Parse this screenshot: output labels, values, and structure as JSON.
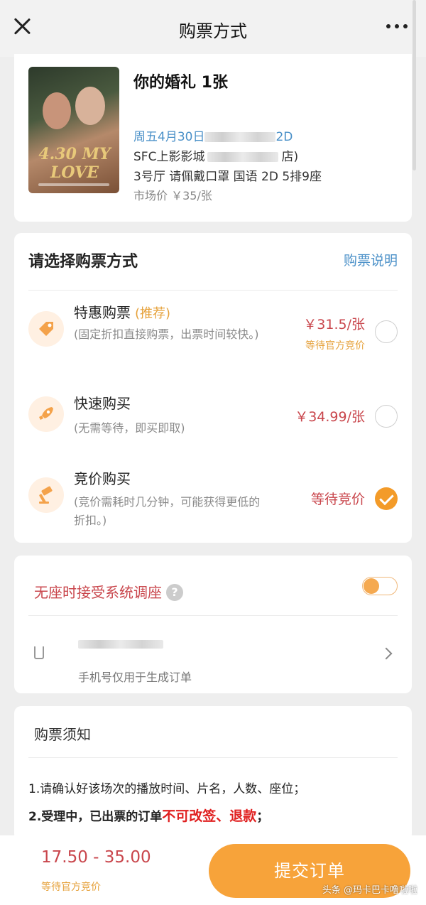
{
  "header": {
    "title": "购票方式"
  },
  "movie": {
    "title": "你的婚礼  1张",
    "showtime": "周五4月30日",
    "showtime_tail": "2D",
    "cinema_prefix": "SFC上影影城",
    "cinema_suffix": "店)",
    "hall": "3号厅 请佩戴口罩 国语 2D 5排9座",
    "market_price": "市场价 ￥35/张",
    "poster_title": "4.30 MY LOVE"
  },
  "methods": {
    "title": "请选择购票方式",
    "help": "购票说明",
    "options": [
      {
        "name": "特惠购票",
        "tag": "(推荐)",
        "desc": "(固定折扣直接购票，出票时间较快。)",
        "price": "￥31.5/张",
        "sub": "等待官方竞价",
        "selected": false
      },
      {
        "name": "快速购买",
        "tag": "",
        "desc": "(无需等待，即买即取)",
        "price": "￥34.99/张",
        "sub": "",
        "selected": false
      },
      {
        "name": "竞价购买",
        "tag": "",
        "desc": "(竞价需耗时几分钟，可能获得更低的折扣。)",
        "price": "等待竞价",
        "sub": "",
        "selected": true
      }
    ]
  },
  "seat": {
    "label": "无座时接受系统调座",
    "qmark": "?",
    "toggle_on": true,
    "phone_hint": "手机号仅用于生成订单"
  },
  "notice": {
    "title": "购票须知",
    "line1": "1.请确认好该场次的播放时间、片名，人数、座位；",
    "line2_prefix": "2.受理中，已出票的订单",
    "line2_red": "不可改签、退款",
    "line2_suffix": "；"
  },
  "bottom": {
    "range": "17.50 - 35.00",
    "wait": "等待官方竞价",
    "submit": "提交订单",
    "watermark": "头条 @玛卡巴卡噜啦啦"
  },
  "colors": {
    "accent": "#f7a33a",
    "price_red": "#c9464c",
    "link_blue": "#4a90c8",
    "tag_orange": "#e6a23c"
  }
}
